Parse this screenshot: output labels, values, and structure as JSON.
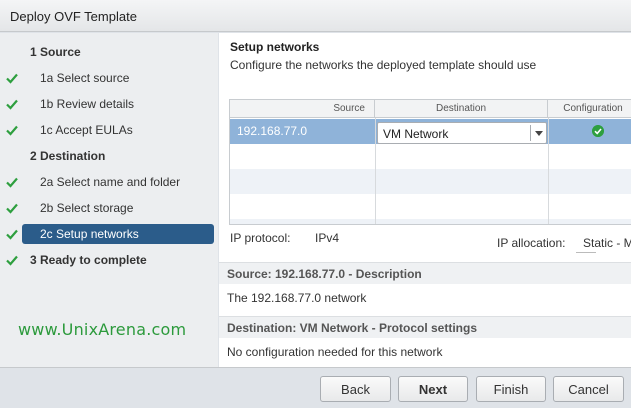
{
  "window": {
    "title": "Deploy OVF Template"
  },
  "steps": [
    {
      "label": "1  Source",
      "type": "section",
      "done": false
    },
    {
      "label": "1a  Select source",
      "type": "sub",
      "done": true
    },
    {
      "label": "1b  Review details",
      "type": "sub",
      "done": true
    },
    {
      "label": "1c  Accept EULAs",
      "type": "sub",
      "done": true
    },
    {
      "label": "2  Destination",
      "type": "section",
      "done": false
    },
    {
      "label": "2a  Select name and folder",
      "type": "sub",
      "done": true
    },
    {
      "label": "2b  Select storage",
      "type": "sub",
      "done": true
    },
    {
      "label": "2c  Setup networks",
      "type": "sub",
      "done": true,
      "active": true
    },
    {
      "label": "3  Ready to complete",
      "type": "section",
      "done": true
    }
  ],
  "watermark": "www.UnixArena.com",
  "main": {
    "title": "Setup networks",
    "subtitle": "Configure the networks the deployed template should use",
    "grid": {
      "columns": [
        "Source",
        "Destination",
        "Configuration"
      ],
      "rows": [
        {
          "source": "192.168.77.0",
          "destination": "VM Network",
          "configuration_status": "ok"
        }
      ]
    },
    "ip_protocol_label": "IP protocol:",
    "ip_protocol_value": "IPv4",
    "ip_allocation_label": "IP allocation:",
    "ip_allocation_value": "Static - M",
    "source_desc_header": "Source: 192.168.77.0 - Description",
    "source_desc_text": "The 192.168.77.0 network",
    "dest_header": "Destination: VM Network - Protocol settings",
    "dest_text": "No configuration needed for this network"
  },
  "buttons": {
    "back": "Back",
    "next": "Next",
    "finish": "Finish",
    "cancel": "Cancel"
  },
  "colors": {
    "accent": "#2b5c8a",
    "check": "#2e9f3f",
    "selected_row": "#8fb3d9",
    "watermark": "#2c9a3c"
  }
}
